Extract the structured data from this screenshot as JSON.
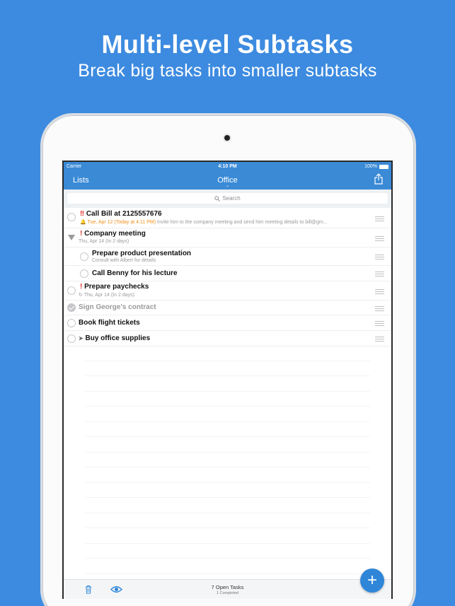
{
  "marketing": {
    "headline": "Multi-level Subtasks",
    "subheadline": "Break big tasks into smaller subtasks"
  },
  "status_bar": {
    "carrier": "Carrier",
    "time": "4:10 PM",
    "battery": "100%"
  },
  "nav": {
    "back_label": "Lists",
    "title": "Office",
    "chevron": "⌄"
  },
  "search": {
    "placeholder": "Search"
  },
  "tasks": [
    {
      "title": "Call Bill at 2125557676",
      "priority": "‼",
      "reminder": "Tue, Apr 12 (Today at 4:11 PM)",
      "note": "Invite him to the company meeting and send him meeting details to bill@gm..."
    },
    {
      "title": "Company meeting",
      "priority": "!",
      "date": "Thu, Apr 14 (In 2 days)"
    },
    {
      "title": "Prepare product presentation",
      "note": "Consult with Albert for details"
    },
    {
      "title": "Call Benny for his lecture"
    },
    {
      "title": "Prepare paychecks",
      "priority": "!",
      "date": "Thu, Apr 14 (In 2 days)"
    },
    {
      "title": "Sign George's contract"
    },
    {
      "title": "Book flight tickets"
    },
    {
      "title": "Buy office supplies"
    }
  ],
  "footer": {
    "open_tasks": "7 Open Tasks",
    "completed": "1 Completed"
  },
  "fab": {
    "label": "+"
  },
  "colors": {
    "background": "#3d8be0",
    "bar": "#3a8ad6",
    "accent": "#2f86d8",
    "priority": "#e0312b",
    "reminder": "#f0901a"
  }
}
